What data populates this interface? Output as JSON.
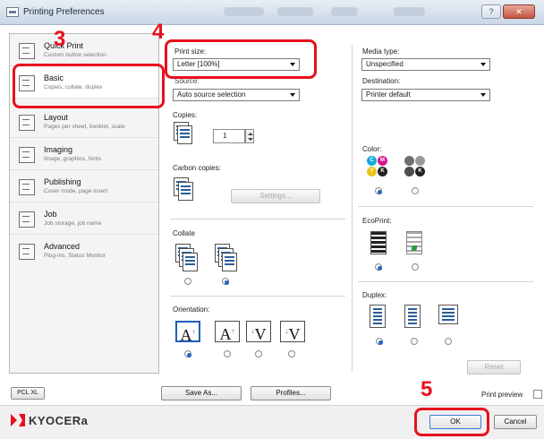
{
  "window": {
    "title": "Printing Preferences",
    "help_glyph": "?",
    "close_glyph": "✕"
  },
  "sidebar": {
    "items": [
      {
        "label": "Quick Print",
        "sub": "Custom button selection"
      },
      {
        "label": "Basic",
        "sub": "Copies, collate, duplex"
      },
      {
        "label": "Layout",
        "sub": "Pages per sheet, booklet, scale"
      },
      {
        "label": "Imaging",
        "sub": "Image, graphics, fonts"
      },
      {
        "label": "Publishing",
        "sub": "Cover mode, page insert"
      },
      {
        "label": "Job",
        "sub": "Job storage, job name"
      },
      {
        "label": "Advanced",
        "sub": "Plug-ins, Status Monitor"
      }
    ],
    "pdl_label": "PCL XL"
  },
  "basic": {
    "print_size_label": "Print size:",
    "print_size_value": "Letter [100%]",
    "source_label": "Source:",
    "source_value": "Auto source selection",
    "copies_label": "Copies:",
    "copies_value": "1",
    "carbon_copies_label": "Carbon copies:",
    "settings_button": "Settings...",
    "collate_label": "Collate",
    "orientation_label": "Orientation:",
    "media_type_label": "Media type:",
    "media_type_value": "Unspecified",
    "destination_label": "Destination:",
    "destination_value": "Printer default",
    "color_label": "Color:",
    "ecoprint_label": "EcoPrint:",
    "duplex_label": "Duplex:",
    "reset_button": "Reset"
  },
  "footer": {
    "save_as_button": "Save As...",
    "profiles_button": "Profiles...",
    "print_preview_label": "Print preview",
    "ok_button": "OK",
    "cancel_button": "Cancel",
    "brand": "KYOCERa"
  },
  "annotations": {
    "n3": "3",
    "n4": "4",
    "n5": "5"
  },
  "colors": {
    "annotation_red": "#e8101c",
    "selection_blue": "#1d67c8",
    "cyan": "#16a9df",
    "magenta": "#d1168e",
    "yellow": "#e8c41c",
    "black": "#222222"
  }
}
